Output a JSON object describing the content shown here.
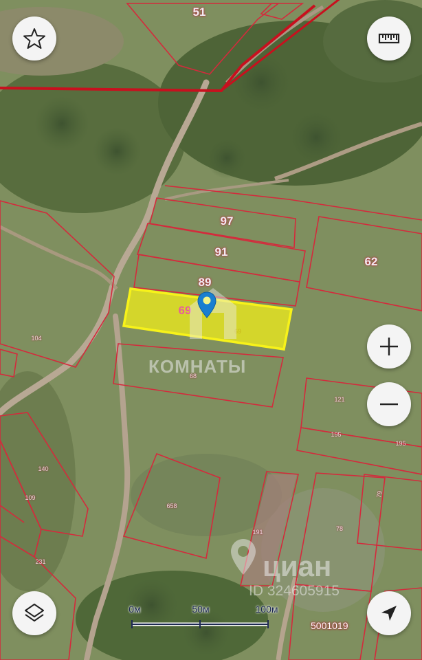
{
  "map": {
    "parcels_big": [
      "51",
      "97",
      "91",
      "89",
      "62"
    ],
    "selected_parcel": "69",
    "selected_parcel_inner": "69",
    "parcels_small": [
      "104",
      "68",
      "121",
      "195",
      "195",
      "140",
      "109",
      "658",
      "191",
      "78",
      "231",
      "79"
    ],
    "cadastral_block": "5001019"
  },
  "watermarks": {
    "komnaty": "КОМНАТЫ",
    "cian": "циан",
    "cian_id": "ID 324605915"
  },
  "scale": {
    "labels": [
      "0м",
      "50м",
      "100м"
    ]
  },
  "controls": {
    "favorite": "star-icon",
    "ruler": "ruler-icon",
    "zoom_in": "plus-icon",
    "zoom_out": "minus-icon",
    "layers": "layers-icon",
    "locate": "navigation-arrow-icon"
  },
  "colors": {
    "parcel_border": "#d42a3c",
    "boundary_line": "#c8101e",
    "selected_fill": "#ecea1c",
    "selected_border": "#f7f21a",
    "pin": "#1a7fd0"
  }
}
